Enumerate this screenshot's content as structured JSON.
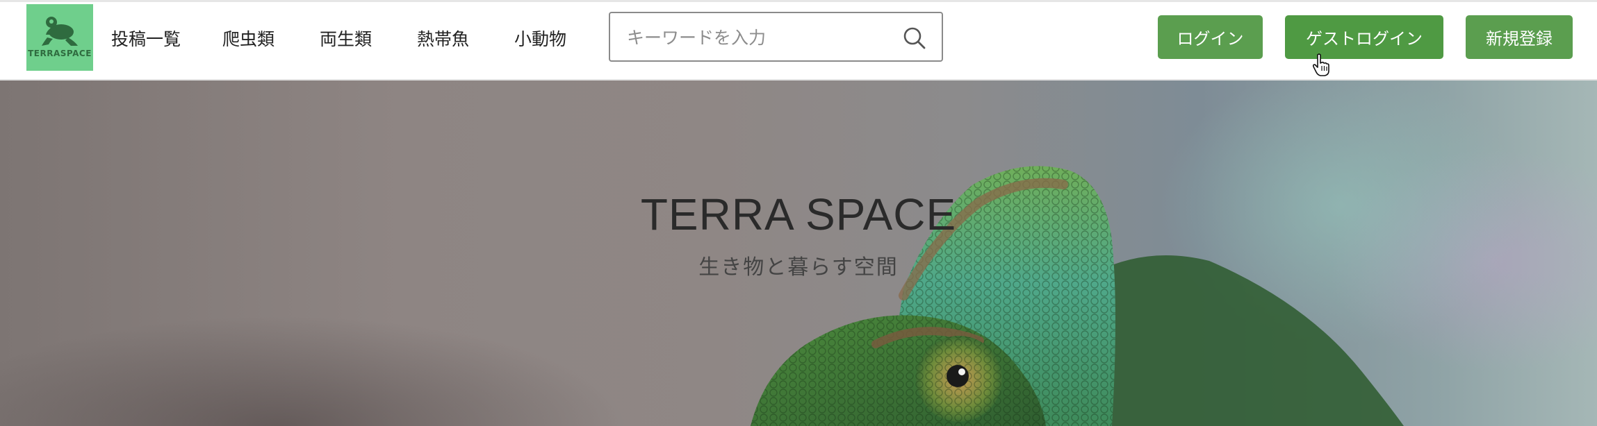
{
  "header": {
    "logo_text": "TERRASPACE",
    "nav": [
      {
        "label": "投稿一覧"
      },
      {
        "label": "爬虫類"
      },
      {
        "label": "両生類"
      },
      {
        "label": "熱帯魚"
      },
      {
        "label": "小動物"
      }
    ],
    "search": {
      "placeholder": "キーワードを入力",
      "value": ""
    },
    "buttons": {
      "login": "ログイン",
      "guest_login": "ゲストログイン",
      "register": "新規登録"
    }
  },
  "hero": {
    "title": "TERRA SPACE",
    "subtitle": "生き物と暮らす空間"
  },
  "colors": {
    "logo_bg": "#6fcf8c",
    "button_green": "#5b9e4f"
  },
  "icons": {
    "logo": "frog-icon",
    "search": "search-icon",
    "cursor": "hand-pointer-icon"
  }
}
